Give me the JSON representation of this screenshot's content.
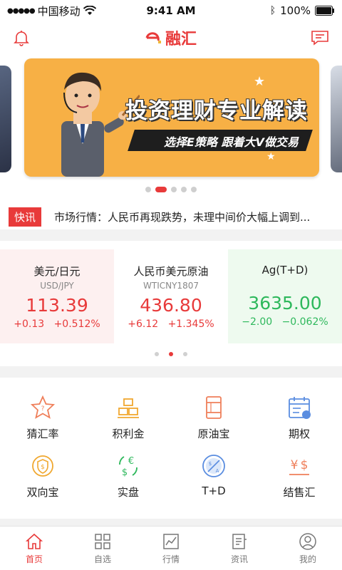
{
  "status": {
    "carrier": "中国移动",
    "time": "9:41 AM",
    "battery": "100%"
  },
  "header": {
    "logo_text": "融汇",
    "left_icon": "bell-icon",
    "right_icon": "message-icon"
  },
  "banner": {
    "title": "投资理财专业解读",
    "subtitle": "选择E策略 跟着大V做交易",
    "active_dot": 1,
    "dot_count": 5
  },
  "news": {
    "badge": "快讯",
    "text": "市场行情：人民币再现跌势，未理中间价大幅上调到..."
  },
  "quotes": [
    {
      "name": "美元/日元",
      "code": "USD/JPY",
      "price": "113.39",
      "change": "+0.13",
      "percent": "+0.512%",
      "trend": "up"
    },
    {
      "name": "人民币美元原油",
      "code": "WTICNY1807",
      "price": "436.80",
      "change": "+6.12",
      "percent": "+1.345%",
      "trend": "up"
    },
    {
      "name": "Ag(T+D)",
      "code": "",
      "price": "3635.00",
      "change": "−2.00",
      "percent": "−0.062%",
      "trend": "down"
    }
  ],
  "quote_dots": {
    "count": 3,
    "active": 1
  },
  "services": [
    {
      "label": "猜汇率",
      "icon": "star-question-icon"
    },
    {
      "label": "积利金",
      "icon": "gold-bars-icon"
    },
    {
      "label": "原油宝",
      "icon": "oil-barrel-icon"
    },
    {
      "label": "期权",
      "icon": "calendar-icon"
    },
    {
      "label": "双向宝",
      "icon": "shield-coin-icon"
    },
    {
      "label": "实盘",
      "icon": "currency-exchange-icon"
    },
    {
      "label": "T+D",
      "icon": "td-coin-icon"
    },
    {
      "label": "结售汇",
      "icon": "yen-dollar-icon"
    }
  ],
  "tabs": [
    {
      "label": "首页",
      "icon": "home-icon",
      "active": true
    },
    {
      "label": "自选",
      "icon": "grid-icon",
      "active": false
    },
    {
      "label": "行情",
      "icon": "chart-icon",
      "active": false
    },
    {
      "label": "资讯",
      "icon": "news-icon",
      "active": false
    },
    {
      "label": "我的",
      "icon": "user-icon",
      "active": false
    }
  ],
  "colors": {
    "accent": "#e83a3a",
    "up": "#e83a3a",
    "down": "#2eb85c",
    "banner": "#f7b045"
  }
}
